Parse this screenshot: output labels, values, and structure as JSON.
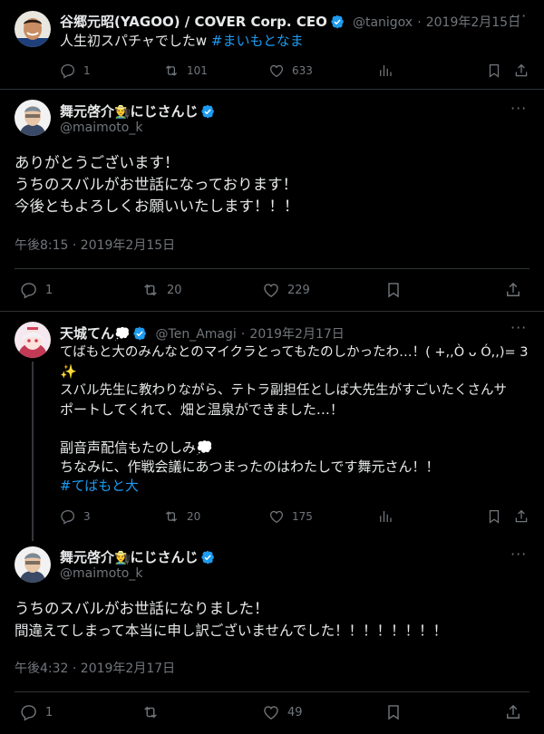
{
  "tweet1": {
    "name": "谷郷元昭(YAGOO) / COVER Corp. CEO",
    "handle": "@tanigox",
    "date": "2019年2月15日",
    "text": "人生初スパチャでしたw ",
    "hashtag": "#まいもとなま",
    "replies": "1",
    "retweets": "101",
    "likes": "633"
  },
  "tweet2": {
    "name": "舞元啓介",
    "name_emoji": "👨‍🌾",
    "name_suffix": "にじさんじ",
    "handle": "@maimoto_k",
    "lines": [
      "ありがとうございます！",
      "うちのスバルがお世話になっております！",
      "今後ともよろしくお願いいたします！！！"
    ],
    "timestamp": "午後8:15 · 2019年2月15日",
    "replies": "1",
    "retweets": "20",
    "likes": "229"
  },
  "tweet3": {
    "name": "天城てん",
    "name_emoji": "💭",
    "handle": "@Ten_Amagi",
    "date": "2019年2月17日",
    "lines": [
      "てばもと大のみんなとのマイクラとってもたのしかったわ…！( +,,Ò ᴗ Ó,,)= 3",
      "✨",
      "スバル先生に教わりながら、テトラ副担任としば大先生がすごいたくさんサ",
      "ポートしてくれて、畑と温泉ができました…！",
      "",
      "副音声配信もたのしみ💭",
      "ちなみに、作戦会議にあつまったのはわたしです舞元さん！！"
    ],
    "hashtag": "#てばもと大",
    "replies": "3",
    "retweets": "20",
    "likes": "175"
  },
  "tweet4": {
    "name": "舞元啓介",
    "name_emoji": "👨‍🌾",
    "name_suffix": "にじさんじ",
    "handle": "@maimoto_k",
    "lines": [
      "うちのスバルがお世話になりました！",
      "間違えてしまって本当に申し訳ございませんでした！！！！！！！！"
    ],
    "timestamp": "午後4:32 · 2019年2月17日",
    "replies": "1",
    "retweets": "",
    "likes": "49"
  },
  "colors": {
    "background": "#000000",
    "text": "#e7e9ea",
    "muted": "#71767b",
    "link": "#1d9bf0",
    "verified": "#1d9bf0"
  }
}
